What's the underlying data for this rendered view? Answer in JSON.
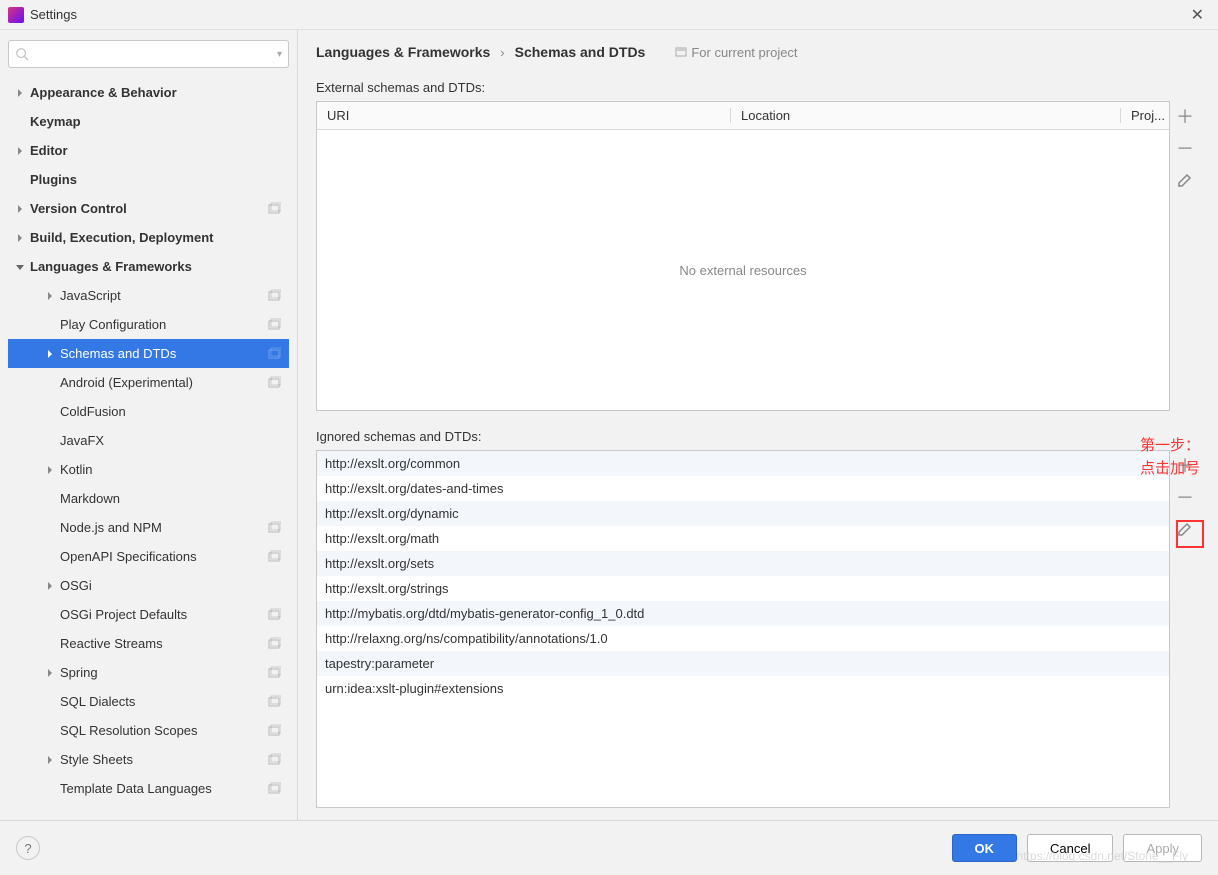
{
  "window": {
    "title": "Settings"
  },
  "breadcrumb": {
    "group": "Languages & Frameworks",
    "page": "Schemas and DTDs",
    "scope": "For current project"
  },
  "sidebar": {
    "items": [
      {
        "label": "Appearance & Behavior",
        "bold": true,
        "arrow": "right",
        "level": 0
      },
      {
        "label": "Keymap",
        "bold": true,
        "arrow": "none",
        "level": 0
      },
      {
        "label": "Editor",
        "bold": true,
        "arrow": "right",
        "level": 0
      },
      {
        "label": "Plugins",
        "bold": true,
        "arrow": "none",
        "level": 0
      },
      {
        "label": "Version Control",
        "bold": true,
        "arrow": "right",
        "level": 0,
        "badge": true
      },
      {
        "label": "Build, Execution, Deployment",
        "bold": true,
        "arrow": "right",
        "level": 0
      },
      {
        "label": "Languages & Frameworks",
        "bold": true,
        "arrow": "down",
        "level": 0
      },
      {
        "label": "JavaScript",
        "arrow": "right",
        "level": 1,
        "badge": true
      },
      {
        "label": "Play Configuration",
        "arrow": "none",
        "level": 1,
        "badge": true
      },
      {
        "label": "Schemas and DTDs",
        "arrow": "right",
        "level": 1,
        "badge": true,
        "selected": true
      },
      {
        "label": "Android (Experimental)",
        "arrow": "none",
        "level": 1,
        "badge": true
      },
      {
        "label": "ColdFusion",
        "arrow": "none",
        "level": 1
      },
      {
        "label": "JavaFX",
        "arrow": "none",
        "level": 1
      },
      {
        "label": "Kotlin",
        "arrow": "right",
        "level": 1
      },
      {
        "label": "Markdown",
        "arrow": "none",
        "level": 1
      },
      {
        "label": "Node.js and NPM",
        "arrow": "none",
        "level": 1,
        "badge": true
      },
      {
        "label": "OpenAPI Specifications",
        "arrow": "none",
        "level": 1,
        "badge": true
      },
      {
        "label": "OSGi",
        "arrow": "right",
        "level": 1
      },
      {
        "label": "OSGi Project Defaults",
        "arrow": "none",
        "level": 1,
        "badge": true
      },
      {
        "label": "Reactive Streams",
        "arrow": "none",
        "level": 1,
        "badge": true
      },
      {
        "label": "Spring",
        "arrow": "right",
        "level": 1,
        "badge": true
      },
      {
        "label": "SQL Dialects",
        "arrow": "none",
        "level": 1,
        "badge": true
      },
      {
        "label": "SQL Resolution Scopes",
        "arrow": "none",
        "level": 1,
        "badge": true
      },
      {
        "label": "Style Sheets",
        "arrow": "right",
        "level": 1,
        "badge": true
      },
      {
        "label": "Template Data Languages",
        "arrow": "none",
        "level": 1,
        "badge": true
      }
    ]
  },
  "external": {
    "label": "External schemas and DTDs:",
    "columns": {
      "uri": "URI",
      "location": "Location",
      "project": "Proj..."
    },
    "empty": "No external resources"
  },
  "ignored": {
    "label": "Ignored schemas and DTDs:",
    "rows": [
      "http://exslt.org/common",
      "http://exslt.org/dates-and-times",
      "http://exslt.org/dynamic",
      "http://exslt.org/math",
      "http://exslt.org/sets",
      "http://exslt.org/strings",
      "http://mybatis.org/dtd/mybatis-generator-config_1_0.dtd",
      "http://relaxng.org/ns/compatibility/annotations/1.0",
      "tapestry:parameter",
      "urn:idea:xslt-plugin#extensions"
    ]
  },
  "annotation": {
    "line1": "第一步：",
    "line2": "点击加号"
  },
  "footer": {
    "ok": "OK",
    "cancel": "Cancel",
    "apply": "Apply"
  },
  "watermark": "https://blog.csdn.net/Stone__Fly"
}
